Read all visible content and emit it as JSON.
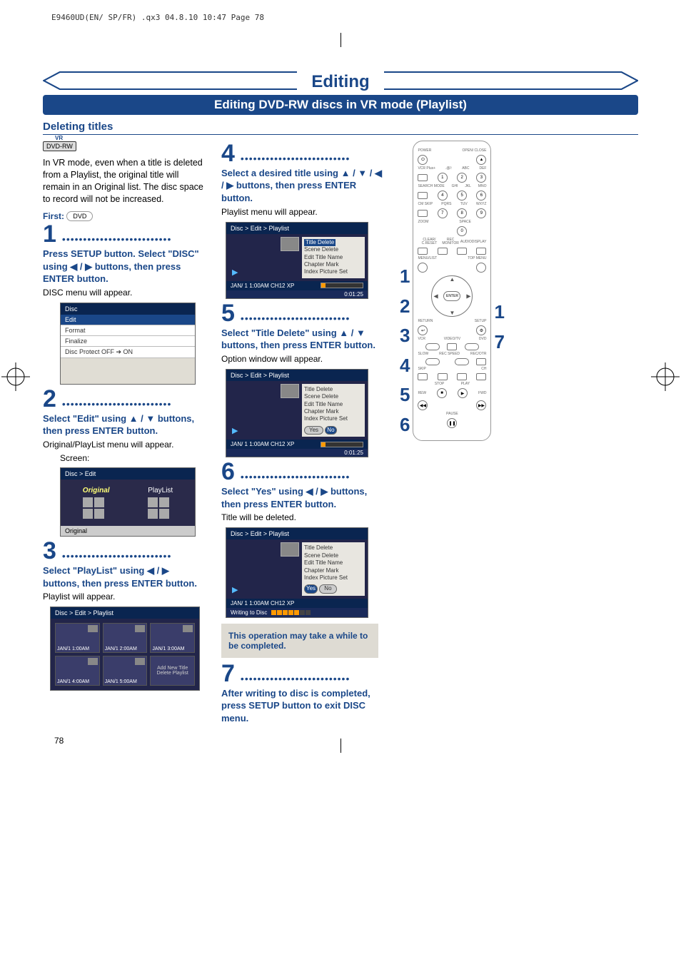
{
  "print_header": "E9460UD(EN/ SP/FR) .qx3  04.8.10  10:47  Page 78",
  "main_title": "Editing",
  "sub_title": "Editing DVD-RW discs in VR mode (Playlist)",
  "section": "Deleting titles",
  "disc_badge": "DVD-RW",
  "intro": "In VR mode, even when a title is deleted from a Playlist, the original title will remain in an Original list. The disc space to record will not be increased.",
  "first_label": "First:",
  "first_badge": "DVD",
  "steps": {
    "s1": {
      "num": "1",
      "bold": "Press SETUP button. Select \"DISC\" using ◀ / ▶ buttons, then press ENTER button.",
      "sub": "DISC menu will appear."
    },
    "s2": {
      "num": "2",
      "bold": "Select \"Edit\" using ▲ / ▼ buttons, then press ENTER button.",
      "sub": "Original/PlayList menu will appear."
    },
    "s3": {
      "num": "3",
      "bold": "Select \"PlayList\" using ◀ / ▶ buttons, then press ENTER button.",
      "sub": "Playlist will appear."
    },
    "s4": {
      "num": "4",
      "bold": "Select a desired title using ▲ / ▼ / ◀ / ▶ buttons, then press ENTER button.",
      "sub": "Playlist menu will appear."
    },
    "s5": {
      "num": "5",
      "bold": "Select \"Title Delete\" using ▲ / ▼ buttons, then press ENTER button.",
      "sub": "Option window will appear."
    },
    "s6": {
      "num": "6",
      "bold": "Select \"Yes\" using ◀ / ▶ buttons, then press ENTER button.",
      "sub": "Title will be deleted."
    },
    "s7": {
      "num": "7",
      "bold": "After writing to disc is completed, press SETUP button to exit DISC menu."
    }
  },
  "screen_label": "Screen:",
  "disc_menu": {
    "title": "Disc",
    "items": [
      "Edit",
      "Format",
      "Finalize",
      "Disc Protect OFF ➔ ON"
    ]
  },
  "edit_menu": {
    "title": "Disc > Edit",
    "tab_original": "Original",
    "tab_playlist": "PlayList",
    "caption": "Original"
  },
  "playlist_screen": {
    "title": "Disc > Edit > Playlist",
    "slots": [
      "JAN/1  1:00AM",
      "JAN/1  2:00AM",
      "JAN/1  3:00AM",
      "JAN/1  4:00AM",
      "JAN/1  5:00AM"
    ],
    "add": "Add  New Title Delete Playlist"
  },
  "detail_screen": {
    "title": "Disc > Edit > Playlist",
    "opts": [
      "Title Delete",
      "Scene Delete",
      "Edit Title Name",
      "Chapter Mark",
      "Index Picture Set"
    ],
    "status": "JAN/ 1   1:00AM  CH12     XP",
    "time": "0:01:25",
    "yes": "Yes",
    "no": "No",
    "writing": "Writing to Disc"
  },
  "note": "This operation may take a while to be completed.",
  "seq_left": [
    "1",
    "2",
    "3",
    "4",
    "5",
    "6"
  ],
  "seq_right": [
    "1",
    "7"
  ],
  "remote": {
    "power": "POWER",
    "open": "OPEN/ CLOSE",
    "vcrplus": "VCR Plus+",
    "search": "SEARCH MODE",
    "cmskip": "CM SKIP",
    "zoom": "ZOOM",
    "clear": "CLEAR/ C.RESET",
    "recmon": "REC MONITOR",
    "audio": "AUDIO",
    "display": "DISPLAY",
    "menulist": "MENU/LIST",
    "topmenu": "TOP MENU",
    "enter": "ENTER",
    "return": "RETURN",
    "setup": "SETUP",
    "vcr": "VCR",
    "videotv": "VIDEO/TV",
    "dvd": "DVD",
    "slow": "SLOW",
    "recspeed": "REC SPEED",
    "recotr": "REC/OTR",
    "skip": "SKIP",
    "ch": "CH",
    "stop": "STOP",
    "play": "PLAY",
    "rew": "REW",
    "fwd": "FWD",
    "pause": "PAUSE",
    "keylabels_row1": [
      ".@/:",
      "ABC",
      "DEF"
    ],
    "keylabels_row2": [
      "GHI",
      "JKL",
      "MNO"
    ],
    "keylabels_row3": [
      "PQRS",
      "TUV",
      "WXYZ"
    ],
    "keylabels_row4": "SPACE"
  },
  "page_num": "78"
}
